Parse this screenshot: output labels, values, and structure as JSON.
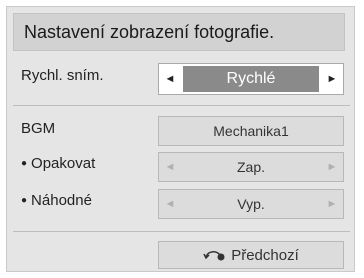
{
  "title": "Nastavení zobrazení fotografie.",
  "slide_speed": {
    "label": "Rychl. sním.",
    "value": "Rychlé",
    "left_arrow": "◄",
    "right_arrow": "►"
  },
  "bgm": {
    "label": "BGM",
    "value": "Mechanika1"
  },
  "repeat": {
    "bullet": "●",
    "label": "Opakovat",
    "value": "Zap.",
    "left_arrow": "◄",
    "right_arrow": "►"
  },
  "random": {
    "bullet": "●",
    "label": "Náhodné",
    "value": "Vyp.",
    "left_arrow": "◄",
    "right_arrow": "►"
  },
  "back_button": {
    "label": "Předchozí",
    "icon": "back-arrow-icon"
  },
  "colors": {
    "panel": "#e5e5e5",
    "title_bar": "#d2d2d2",
    "highlight": "#8a8a8a"
  }
}
